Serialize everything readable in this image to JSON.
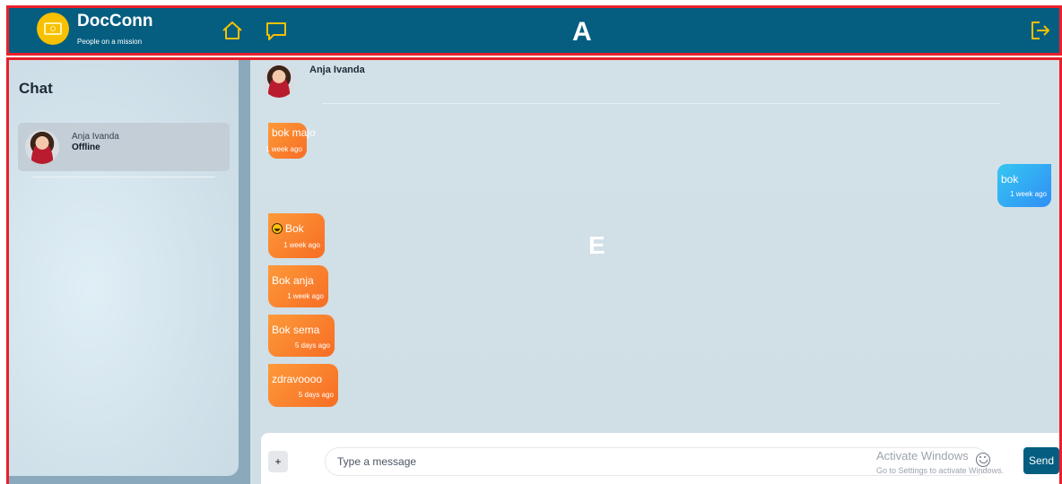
{
  "navbar": {
    "brand": "DocConn",
    "tagline": "People on a mission",
    "annotation_label": "A",
    "background_color": "#055e80",
    "icons": [
      "logo-icon",
      "home-icon",
      "chat-icon",
      "logout-icon"
    ]
  },
  "sidebar": {
    "title": "Chat",
    "contacts": [
      {
        "name": "Anja Ivanda",
        "status": "Offline"
      }
    ]
  },
  "chat": {
    "contact_name": "Anja Ivanda",
    "annotation_label": "E",
    "messages": [
      {
        "direction": "incoming",
        "text": "bok majo",
        "time": "1 week ago"
      },
      {
        "direction": "outgoing",
        "text": "bok",
        "time": "1 week ago"
      },
      {
        "direction": "incoming",
        "text": "Bok",
        "emoji": "grinning-face",
        "time": "1 week ago"
      },
      {
        "direction": "incoming",
        "text": "Bok anja",
        "time": "1 week ago"
      },
      {
        "direction": "incoming",
        "text": "Bok sema",
        "time": "5 days ago"
      },
      {
        "direction": "incoming",
        "text": "zdravoooo",
        "time": "5 days ago"
      }
    ],
    "incoming_color": "#f7792a",
    "outgoing_color": "#2f9cf5"
  },
  "composer": {
    "attach_label": "+",
    "placeholder": "Type a message",
    "send_label": "Send"
  },
  "overlay": {
    "activate_title": "Activate Windows",
    "activate_subtitle": "Go to Settings to activate Windows."
  }
}
